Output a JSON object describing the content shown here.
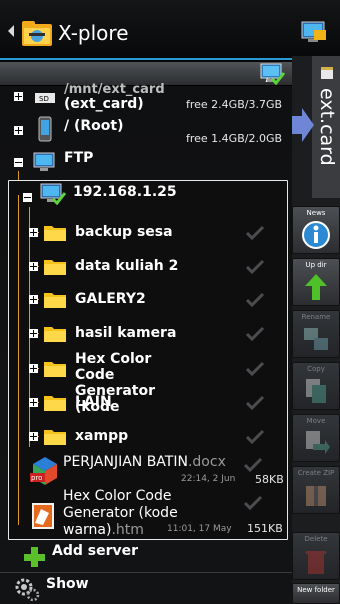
{
  "app": {
    "title": "X-plore"
  },
  "path_bar": {
    "path": "/"
  },
  "side_tab": {
    "label": "ext.card"
  },
  "tree": {
    "ext_card": {
      "path": "/mnt/ext_card",
      "name": "(ext_card)",
      "free": "free 2.4GB/3.7GB"
    },
    "root": {
      "name": "/ (Root)",
      "free": "free 1.4GB/2.0GB"
    },
    "ftp": {
      "name": "FTP"
    },
    "server": {
      "name": "192.168.1.25"
    },
    "folders": [
      "backup sesa",
      "data kuliah 2",
      "GALERY2",
      "hasil kamera",
      "Hex Color Code Generator (kode",
      "LAIN",
      "xampp"
    ],
    "files": [
      {
        "base": "PERJANJIAN BATIN",
        "ext": ".docx",
        "date": "22:14, 2 Jun",
        "size": "58KB",
        "badge": "pro"
      },
      {
        "base": "Hex Color Code Generator (kode warna)",
        "ext": ".htm",
        "date": "11:01, 17 May",
        "size": "151KB"
      }
    ]
  },
  "bottom": {
    "add_server": "Add server",
    "show": "Show"
  },
  "toolbar": {
    "news": "News",
    "up_dir": "Up dir",
    "rename": "Rename",
    "copy": "Copy",
    "move": "Move",
    "create_zip": "Create ZIP",
    "delete": "Delete",
    "new_folder": "New folder"
  },
  "colors": {
    "accent": "#2a9ad6",
    "folder": "#f4c21b",
    "tree_line": "#d99a2a"
  }
}
